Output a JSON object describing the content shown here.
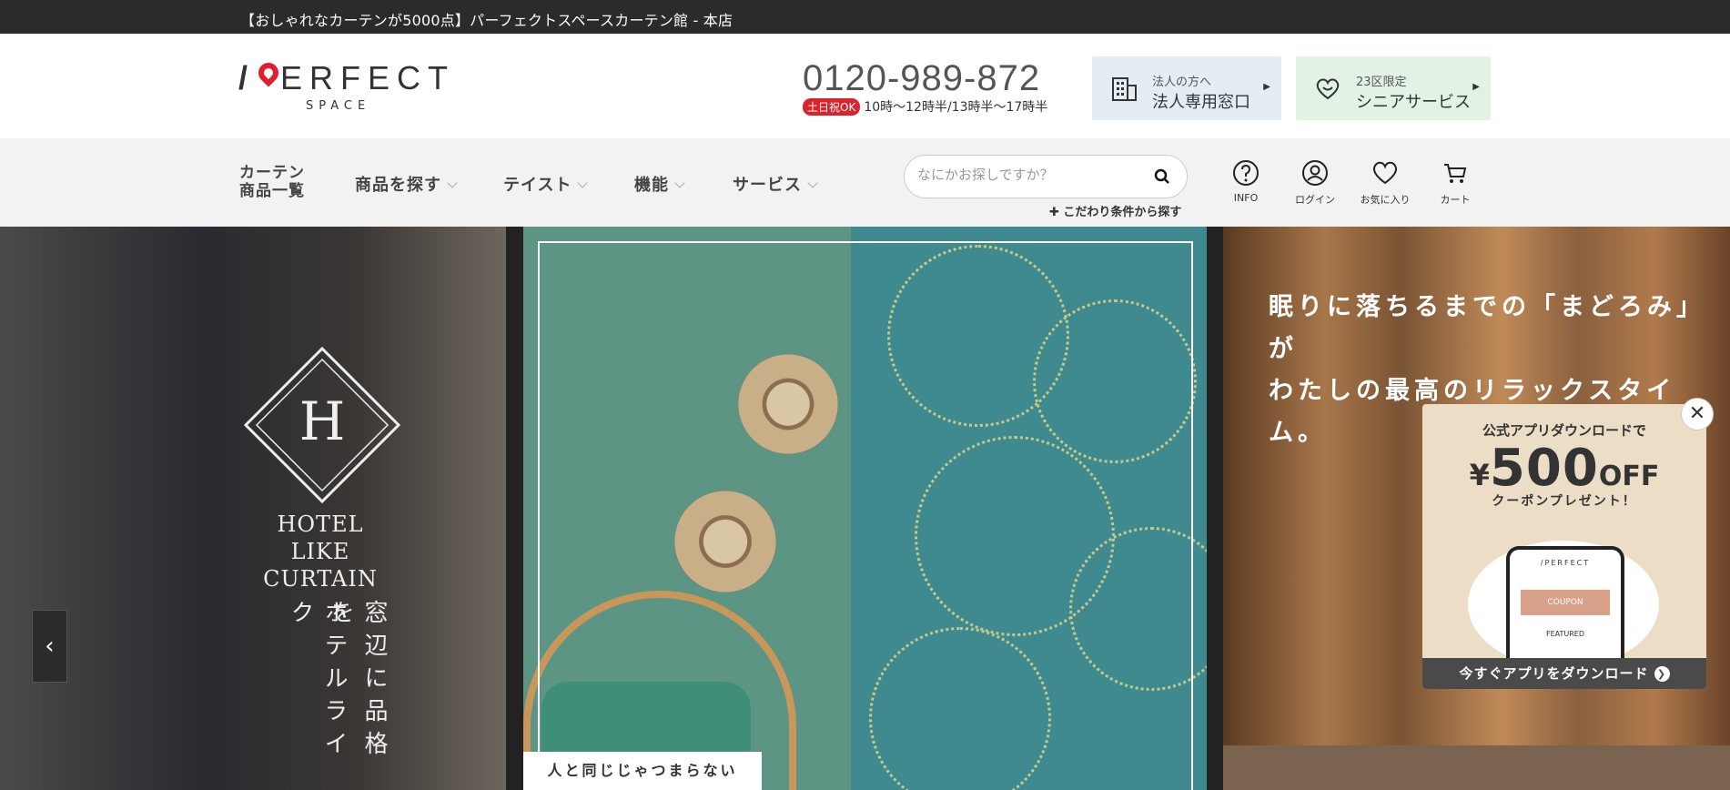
{
  "topbar": {
    "text": "【おしゃれなカーテンが5000点】パーフェクトスペースカーテン館 - 本店"
  },
  "header": {
    "logo_mark": "/",
    "logo_word": "ERFECT",
    "logo_sub": "SPACE",
    "phone": "0120-989-872",
    "badge": "土日祝OK",
    "hours": "10時〜12時半/13時半〜17時半",
    "corporate": {
      "small": "法人の方へ",
      "big": "法人専用窓口"
    },
    "senior": {
      "small": "23区限定",
      "big": "シニアサービス"
    }
  },
  "nav": {
    "curtain_list_line1": "カーテン",
    "curtain_list_line2": "商品一覧",
    "items": [
      "商品を探す",
      "テイスト",
      "機能",
      "サービス"
    ],
    "search_placeholder": "なにかお探しですか？",
    "advanced": "✚ こだわり条件から探す",
    "utils": [
      "INFO",
      "ログイン",
      "お気に入り",
      "カート"
    ]
  },
  "hero": {
    "slide1": {
      "emblem_letter": "H",
      "title_line1": "HOTEL LIKE",
      "title_line2": "CURTAIN",
      "vertical_col1": "窓辺に品格を",
      "vertical_col2": "ホテルライク"
    },
    "slide2": {
      "caption": "人と同じじゃつまらない"
    },
    "slide3": {
      "line1": "眠りに落ちるまでの「まどろみ」が",
      "line2": "わたしの最高のリラックスタイム。"
    }
  },
  "popup": {
    "title": "公式アプリダウンロードで",
    "yen": "¥",
    "amount": "500",
    "off": "OFF",
    "subtitle": "クーポンプレゼント！",
    "phone_logo": "/PERFECT",
    "phone_coupon": "COUPON",
    "phone_featured": "FEATURED",
    "download": "今すぐアプリをダウンロード",
    "close": "✕"
  },
  "colors": {
    "topbar": "#2b2b2b",
    "accent_red": "#e01e2d",
    "nav_bg": "#f2f2f2"
  }
}
